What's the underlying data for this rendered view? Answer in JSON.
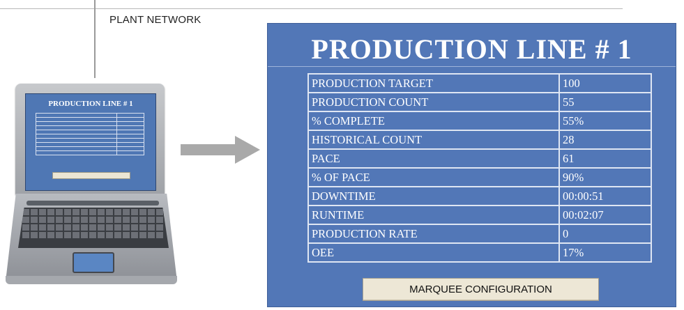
{
  "network": {
    "label": "PLANT NETWORK"
  },
  "laptop": {
    "icon": "laptop-icon",
    "screen_title": "PRODUCTION LINE # 1"
  },
  "arrow": {
    "icon": "arrow-right-icon"
  },
  "panel": {
    "title": "PRODUCTION LINE # 1",
    "rows": [
      {
        "label": "PRODUCTION TARGET",
        "value": "100"
      },
      {
        "label": "PRODUCTION COUNT",
        "value": "55"
      },
      {
        "label": "% COMPLETE",
        "value": "55%"
      },
      {
        "label": "HISTORICAL COUNT",
        "value": "28"
      },
      {
        "label": "PACE",
        "value": "61"
      },
      {
        "label": "% OF PACE",
        "value": "90%"
      },
      {
        "label": "DOWNTIME",
        "value": "00:00:51"
      },
      {
        "label": "RUNTIME",
        "value": "00:02:07"
      },
      {
        "label": "PRODUCTION RATE",
        "value": "0"
      },
      {
        "label": "OEE",
        "value": "17%"
      }
    ],
    "button_label": "MARQUEE CONFIGURATION"
  },
  "colors": {
    "panel_bg": "#5277b7",
    "table_border": "#dfe6f3",
    "button_bg": "#ede7d6"
  }
}
